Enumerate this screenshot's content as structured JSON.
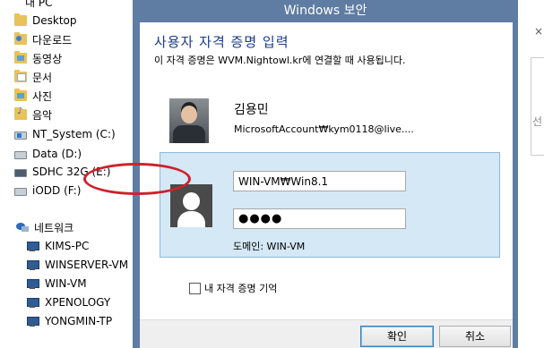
{
  "explorer": {
    "my_pc": "내 PC",
    "items": [
      {
        "label": "Desktop",
        "icon": "desktop-folder-icon"
      },
      {
        "label": "다운로드",
        "icon": "downloads-folder-icon"
      },
      {
        "label": "동영상",
        "icon": "videos-folder-icon"
      },
      {
        "label": "문서",
        "icon": "documents-folder-icon"
      },
      {
        "label": "사진",
        "icon": "pictures-folder-icon"
      },
      {
        "label": "음악",
        "icon": "music-folder-icon"
      },
      {
        "label": "NT_System (C:)",
        "icon": "system-drive-icon"
      },
      {
        "label": "Data (D:)",
        "icon": "drive-icon"
      },
      {
        "label": "SDHC 32G (E:)",
        "icon": "sd-card-icon"
      },
      {
        "label": "iODD (F:)",
        "icon": "drive-icon"
      }
    ],
    "network": {
      "label": "네트워크",
      "icon": "network-icon"
    },
    "network_items": [
      "KIMS-PC",
      "WINSERVER-VM",
      "WIN-VM",
      "XPENOLOGY",
      "YONGMIN-TP"
    ]
  },
  "background_right": {
    "close": "×",
    "label": "선"
  },
  "dialog": {
    "title": "Windows 보안",
    "heading": "사용자 자격 증명 입력",
    "subtext": "이 자격 증명은 WVM.Nightowl.kr에 연결할 때 사용됩니다.",
    "current_user": {
      "name": "김용민",
      "account": "MicrosoftAccount₩kym0118@live...."
    },
    "credential": {
      "username": "WIN-VM₩Win8.1",
      "password_mask": "●●●●",
      "domain": "도메인: WIN-VM"
    },
    "remember_label": "내 자격 증명 기억",
    "remember_checked": false,
    "ok_label": "확인",
    "cancel_label": "취소",
    "highlight_color": "#d0202a"
  }
}
